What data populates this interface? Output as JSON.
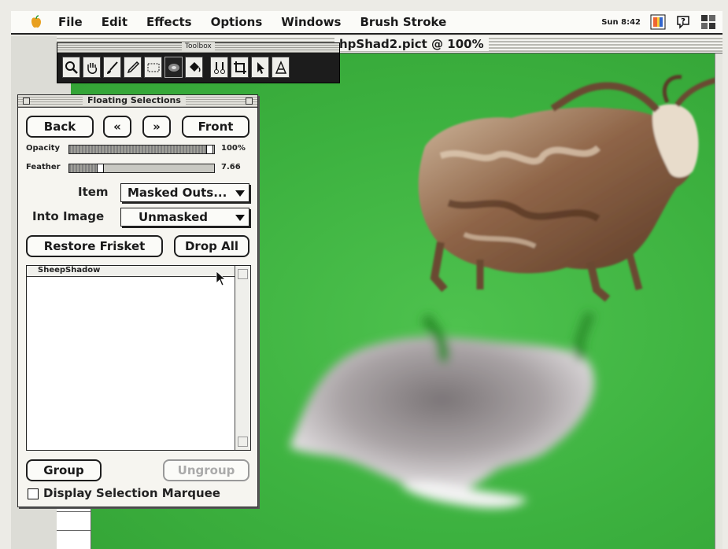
{
  "menubar": {
    "items": [
      "File",
      "Edit",
      "Effects",
      "Options",
      "Windows",
      "Brush Stroke"
    ],
    "clock": "Sun 8:42",
    "right_icons": [
      "color-picker-icon",
      "help-icon",
      "app-switcher-icon"
    ]
  },
  "document": {
    "title": "hpShad2.pict @ 100%"
  },
  "toolbox": {
    "title": "Toolbox",
    "tools": [
      "magnifier-icon",
      "hand-icon",
      "brush-icon",
      "dropper-icon",
      "selection-rect-icon",
      "object-selector-icon",
      "paint-bucket-icon",
      "scissors-icon",
      "crop-icon",
      "arrow-pointer-icon",
      "text-icon"
    ]
  },
  "floating_selections": {
    "title": "Floating Selections",
    "back": "Back",
    "prev": "«",
    "next": "»",
    "front": "Front",
    "opacity_label": "Opacity",
    "opacity_value": "100%",
    "opacity_fraction": 1.0,
    "feather_label": "Feather",
    "feather_value": "7.66",
    "feather_fraction": 0.2,
    "item_label": "Item",
    "item_value": "Masked Outs...",
    "into_label": "Into Image",
    "into_value": "Unmasked",
    "restore_frisket": "Restore Frisket",
    "drop_all": "Drop All",
    "list_header": "SheepShadow",
    "group": "Group",
    "ungroup": "Ungroup",
    "display_marquee": "Display Selection Marquee"
  }
}
